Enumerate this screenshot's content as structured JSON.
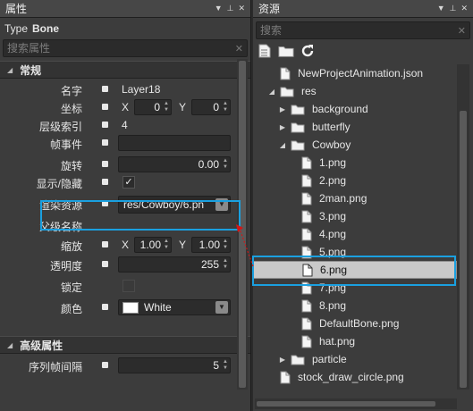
{
  "properties_panel": {
    "title": "属性",
    "type_label": "Type",
    "type_value": "Bone",
    "search_placeholder": "搜索属性",
    "sections": {
      "general": "常规",
      "advanced": "高级属性"
    },
    "fields": {
      "name_label": "名字",
      "name_value": "Layer18",
      "position_label": "坐标",
      "position_x_axis": "X",
      "position_x": "0",
      "position_y_axis": "Y",
      "position_y": "0",
      "layer_index_label": "层级索引",
      "layer_index_value": "4",
      "frame_event_label": "帧事件",
      "frame_event_value": "",
      "rotation_label": "旋转",
      "rotation_value": "0.00",
      "visible_label": "显示/隐藏",
      "visible_check": "✓",
      "render_resource_label": "渲染资源",
      "render_resource_value": "res/Cowboy/6.pn",
      "parent_label": "父级名称",
      "scale_label": "缩放",
      "scale_x_axis": "X",
      "scale_x": "1.00",
      "scale_y_axis": "Y",
      "scale_y": "1.00",
      "opacity_label": "透明度",
      "opacity_value": "255",
      "lock_label": "锁定",
      "color_label": "颜色",
      "color_value": "White",
      "frame_interval_label": "序列帧间隔",
      "frame_interval_value": "5"
    }
  },
  "resources_panel": {
    "title": "资源",
    "search_placeholder": "搜索",
    "tree": [
      {
        "label": "NewProjectAnimation.json",
        "kind": "file"
      },
      {
        "label": "res",
        "kind": "folder",
        "open": true
      },
      {
        "label": "background",
        "kind": "folder",
        "open": false
      },
      {
        "label": "butterfly",
        "kind": "folder",
        "open": false
      },
      {
        "label": "Cowboy",
        "kind": "folder",
        "open": true
      },
      {
        "label": "1.png",
        "kind": "file"
      },
      {
        "label": "2.png",
        "kind": "file"
      },
      {
        "label": "2man.png",
        "kind": "file"
      },
      {
        "label": "3.png",
        "kind": "file"
      },
      {
        "label": "4.png",
        "kind": "file"
      },
      {
        "label": "5.png",
        "kind": "file"
      },
      {
        "label": "6.png",
        "kind": "file",
        "selected": true
      },
      {
        "label": "7.png",
        "kind": "file"
      },
      {
        "label": "8.png",
        "kind": "file"
      },
      {
        "label": "DefaultBone.png",
        "kind": "file"
      },
      {
        "label": "hat.png",
        "kind": "file"
      },
      {
        "label": "particle",
        "kind": "folder",
        "open": false
      },
      {
        "label": "stock_draw_circle.png",
        "kind": "file"
      }
    ]
  },
  "colors": {
    "highlight": "#1aa0e0",
    "arrow": "#d01818",
    "panel_bg": "#3c3c3c"
  }
}
